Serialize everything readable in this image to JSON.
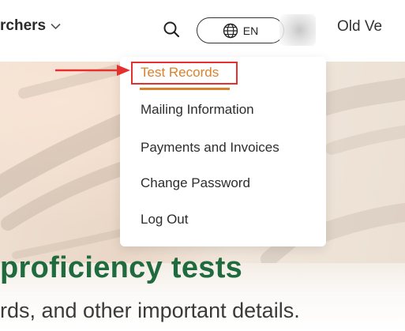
{
  "header": {
    "nav_researchers": "rchers",
    "language_label": "EN",
    "nav_old": "Old Ve"
  },
  "icons": {
    "chevron": "chevron-down-icon",
    "search": "search-icon",
    "globe": "globe-icon",
    "annotation_arrow": "red-arrow-icon"
  },
  "account_menu": {
    "items": [
      {
        "label": "Test Records",
        "active": true
      },
      {
        "label": "Mailing Information"
      },
      {
        "label": "Payments and Invoices"
      },
      {
        "label": "Change Password"
      },
      {
        "label": "Log Out"
      }
    ]
  },
  "hero": {
    "title": "proficiency tests",
    "subtitle": "rds, and other important details."
  },
  "colors": {
    "accent_orange": "#d9822b",
    "highlight_red": "#e53030",
    "title_green": "#1f6b3d"
  }
}
